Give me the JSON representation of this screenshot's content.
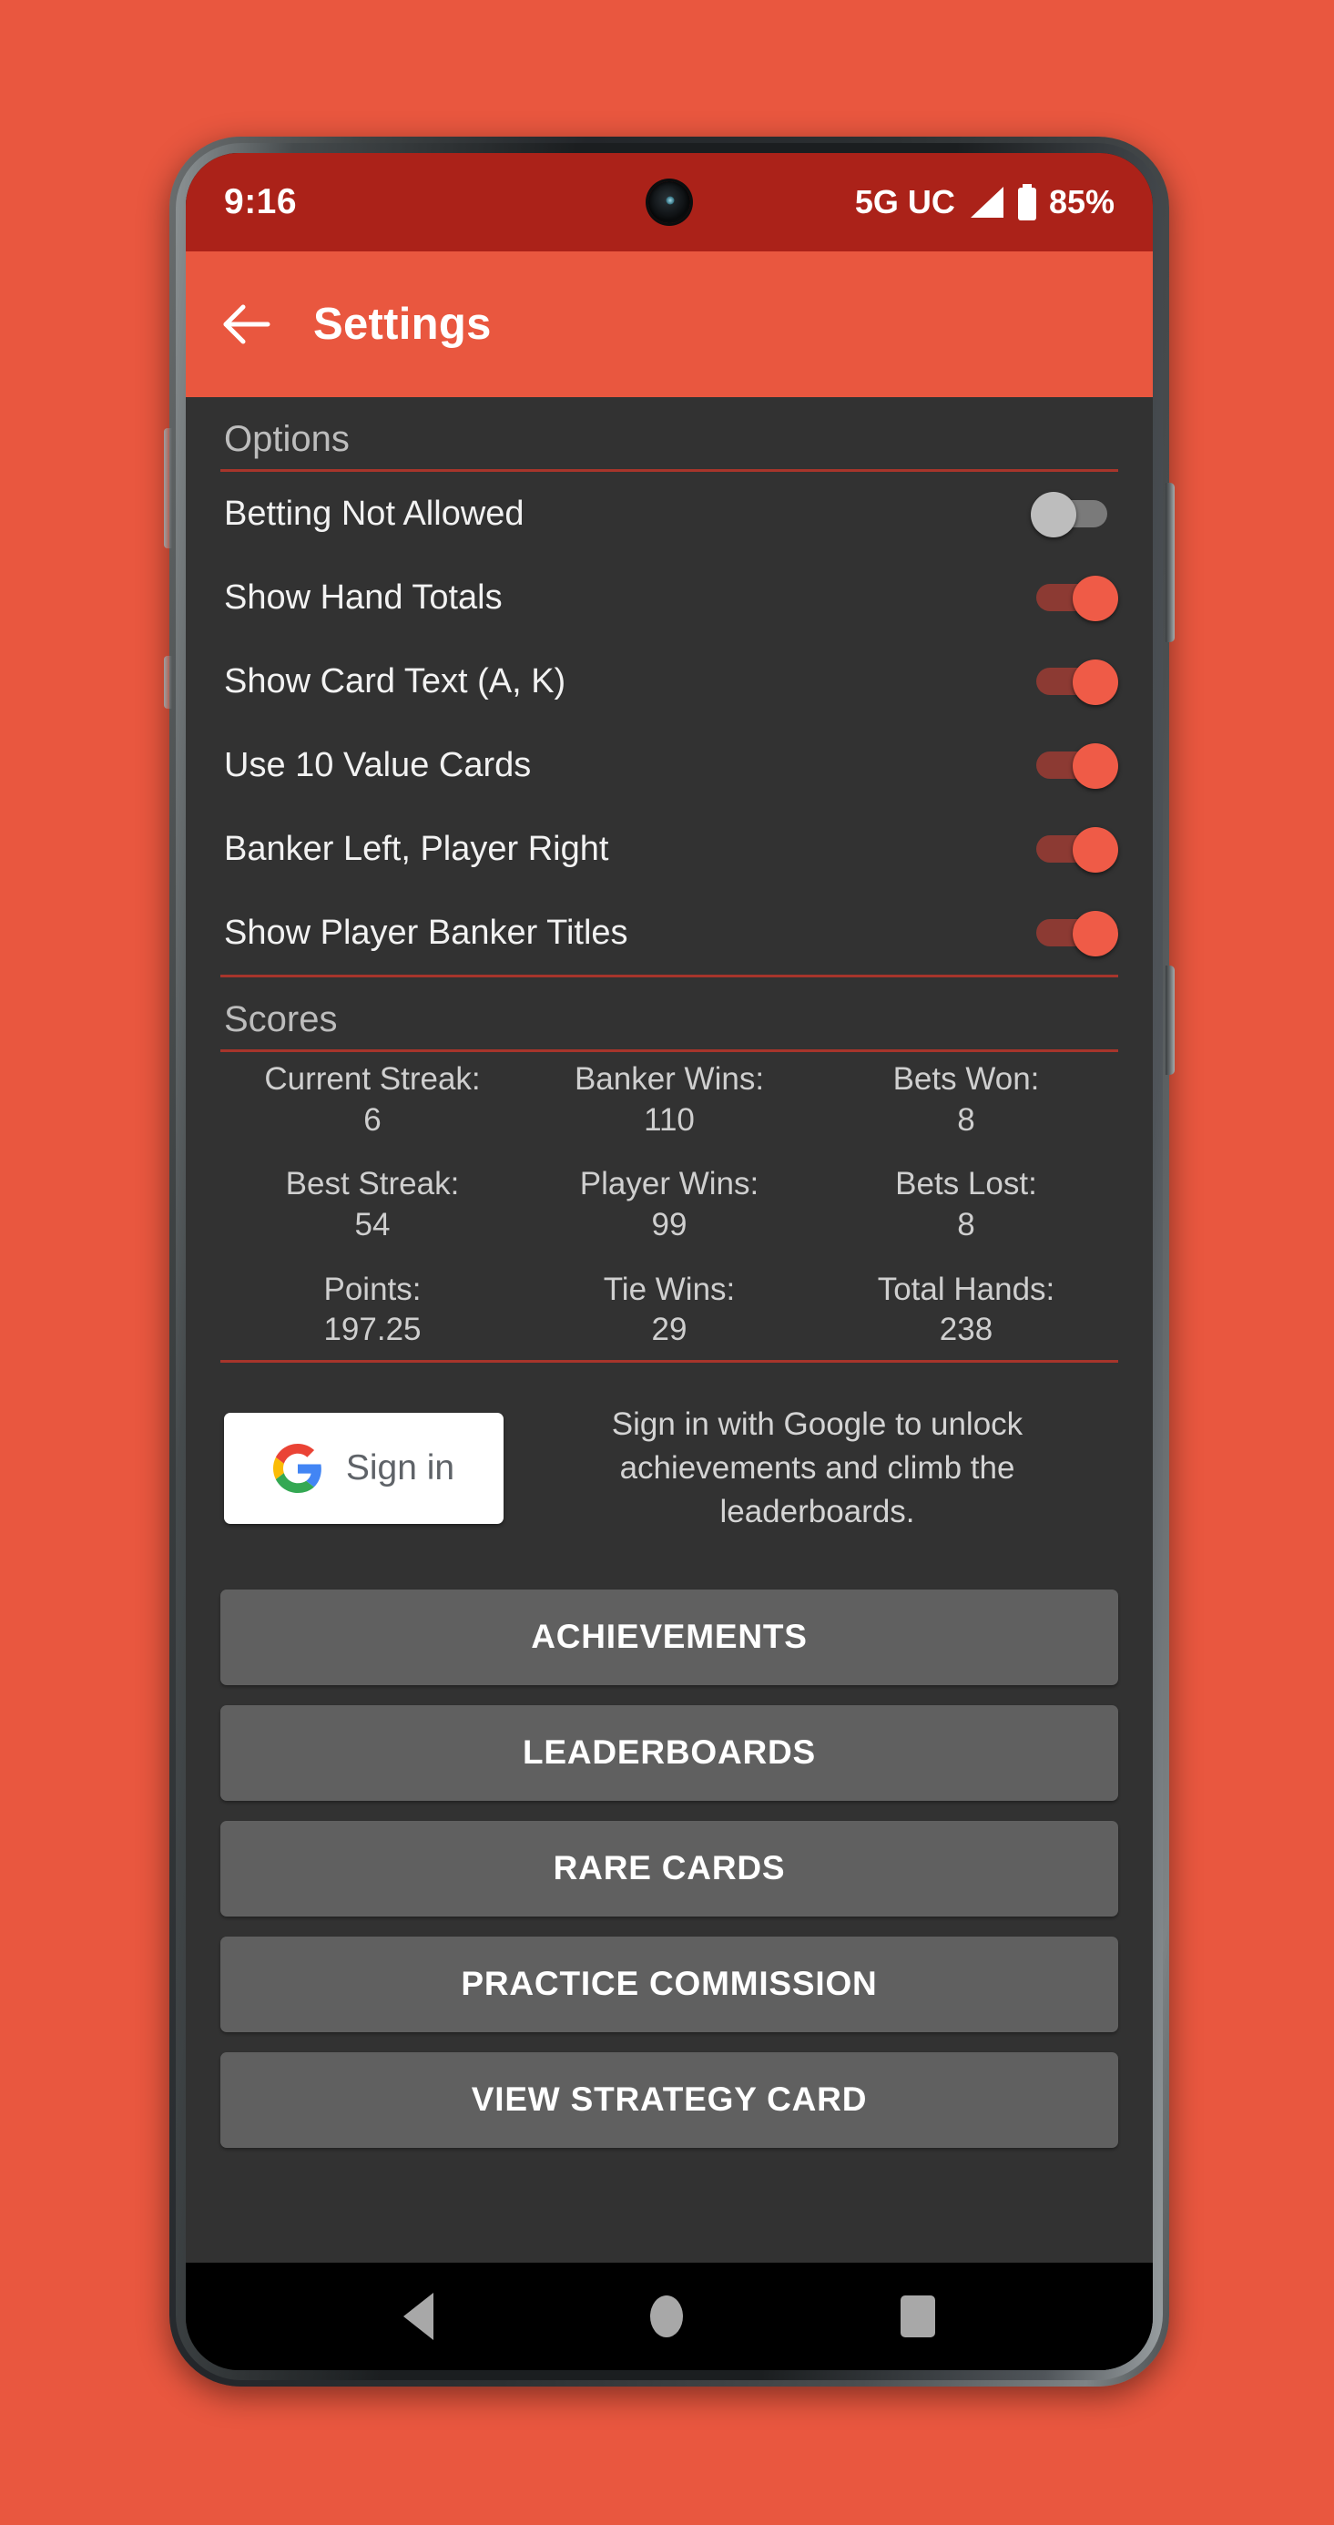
{
  "status_bar": {
    "time": "9:16",
    "network": "5G UC",
    "battery_percent": "85%",
    "signal_icon": "signal-bars-icon",
    "battery_icon": "battery-icon",
    "camera_icon": "front-camera-punch-hole"
  },
  "app_bar": {
    "back_icon": "back-arrow-icon",
    "title": "Settings"
  },
  "options": {
    "header": "Options",
    "items": [
      {
        "label": "Betting Not Allowed",
        "state": "off"
      },
      {
        "label": "Show Hand Totals",
        "state": "on"
      },
      {
        "label": "Show Card Text (A, K)",
        "state": "on"
      },
      {
        "label": "Use 10 Value Cards",
        "state": "on"
      },
      {
        "label": "Banker Left, Player Right",
        "state": "on"
      },
      {
        "label": "Show Player Banker Titles",
        "state": "on"
      }
    ]
  },
  "scores": {
    "header": "Scores",
    "cells": [
      {
        "label": "Current Streak:",
        "value": "6"
      },
      {
        "label": "Banker Wins:",
        "value": "110"
      },
      {
        "label": "Bets Won:",
        "value": "8"
      },
      {
        "label": "Best Streak:",
        "value": "54"
      },
      {
        "label": "Player Wins:",
        "value": "99"
      },
      {
        "label": "Bets Lost:",
        "value": "8"
      },
      {
        "label": "Points:",
        "value": "197.25"
      },
      {
        "label": "Tie Wins:",
        "value": "29"
      },
      {
        "label": "Total Hands:",
        "value": "238"
      }
    ]
  },
  "signin": {
    "google_icon": "google-g-icon",
    "button_label": "Sign in",
    "description": "Sign in with Google to unlock achievements and climb the leaderboards."
  },
  "actions": [
    {
      "label": "ACHIEVEMENTS"
    },
    {
      "label": "LEADERBOARDS"
    },
    {
      "label": "RARE CARDS"
    },
    {
      "label": "PRACTICE COMMISSION"
    },
    {
      "label": "VIEW STRATEGY CARD"
    }
  ],
  "nav_bar": {
    "back_icon": "nav-back-triangle-icon",
    "home_icon": "nav-home-circle-icon",
    "recents_icon": "nav-recents-square-icon"
  },
  "colors": {
    "page_background": "#e9573f",
    "status_bar": "#ab2219",
    "app_bar": "#e9573f",
    "screen_background": "#323232",
    "accent_red": "#ef5b47",
    "divider_red": "#a7352b",
    "button_grey": "#606060"
  }
}
